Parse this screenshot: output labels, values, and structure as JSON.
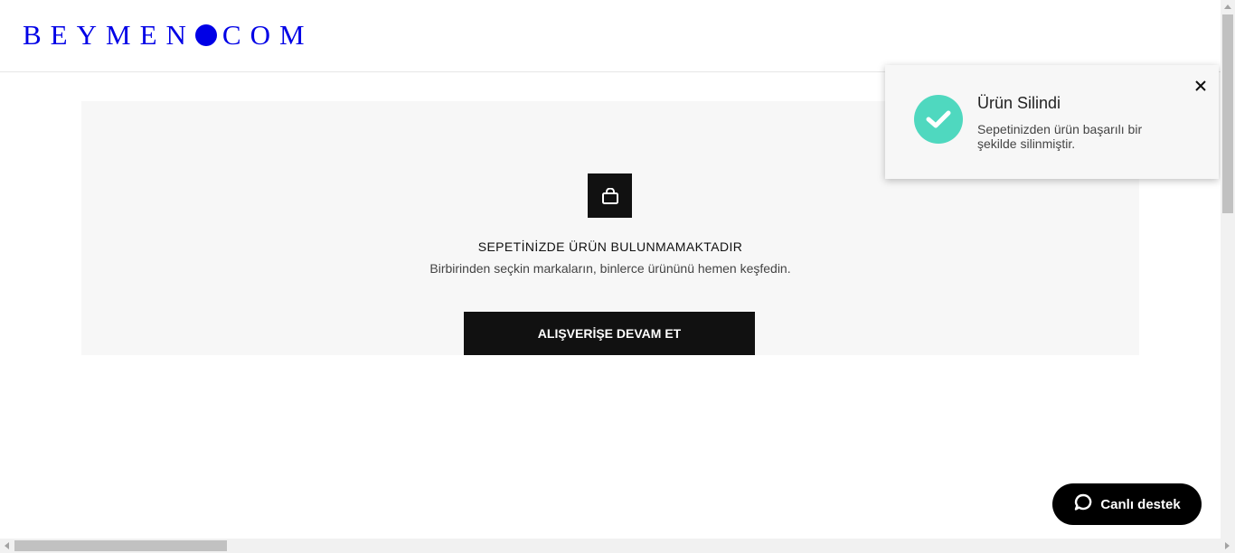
{
  "header": {
    "logo_left": "BEYMEN",
    "logo_right": "COM"
  },
  "cart": {
    "icon": "shopping-bag-icon",
    "empty_title": "SEPETİNİZDE ÜRÜN BULUNMAMAKTADIR",
    "empty_subtitle": "Birbirinden seçkin markaların, binlerce ürününü hemen keşfedin.",
    "cta_label": "ALIŞVERİŞE DEVAM ET"
  },
  "toast": {
    "icon": "check-circle-icon",
    "title": "Ürün Silindi",
    "message": "Sepetinizden ürün başarılı bir şekilde silinmiştir.",
    "close_icon": "close-icon",
    "accent_color": "#4fd8bf"
  },
  "chat": {
    "icon": "chat-bubble-icon",
    "label": "Canlı destek"
  },
  "colors": {
    "brand": "#0000e6",
    "button": "#111111",
    "panel": "#f7f7f7"
  }
}
